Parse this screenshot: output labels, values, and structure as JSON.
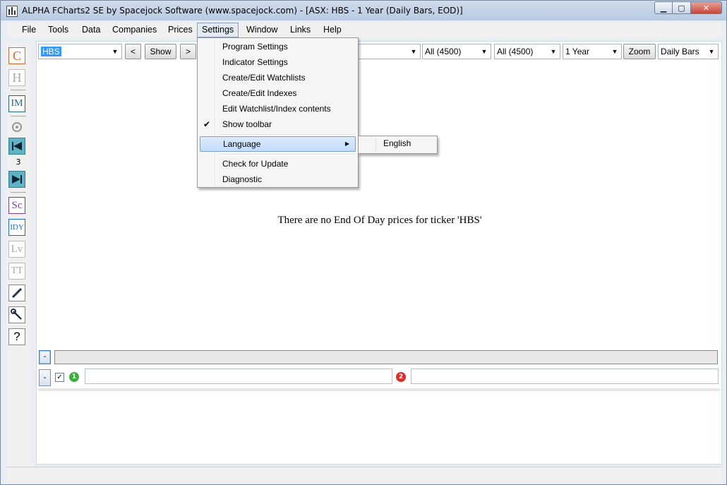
{
  "window": {
    "title": "ALPHA FCharts2 SE by Spacejock Software (www.spacejock.com) - [ASX: HBS - 1 Year (Daily Bars, EOD)]",
    "minimize": "▁",
    "maximize": "▢",
    "close": "✕"
  },
  "menu": [
    "File",
    "Tools",
    "Data",
    "Companies",
    "Prices",
    "Settings",
    "Window",
    "Links",
    "Help"
  ],
  "toolbar_left": {
    "c": "C",
    "h": "H",
    "im": "IM",
    "count": "3",
    "sc": "Sc",
    "idy": "IDY",
    "lv": "Lv",
    "tt": "TT",
    "help": "?"
  },
  "top_toolbar": {
    "ticker": "HBS",
    "prev": "<",
    "show": "Show",
    "next": ">",
    "filter1": "All (4500)",
    "filter2": "All (4500)",
    "period": "1 Year",
    "zoom": "Zoom",
    "bars": "Daily Bars"
  },
  "message": "There are no End Of Day prices for ticker 'HBS'",
  "bottom": {
    "collapse1": "-",
    "collapse2": "-",
    "check": "✓",
    "marker1": "1",
    "marker2": "2"
  },
  "settings_menu": {
    "items": [
      "Program Settings",
      "Indicator Settings",
      "Create/Edit Watchlists",
      "Create/Edit Indexes",
      "Edit Watchlist/Index contents",
      "Show toolbar",
      "Language",
      "Check for Update",
      "Diagnostic"
    ],
    "checkmark": "✔",
    "submenu_arrow": "▶",
    "language_submenu": [
      "English"
    ]
  }
}
